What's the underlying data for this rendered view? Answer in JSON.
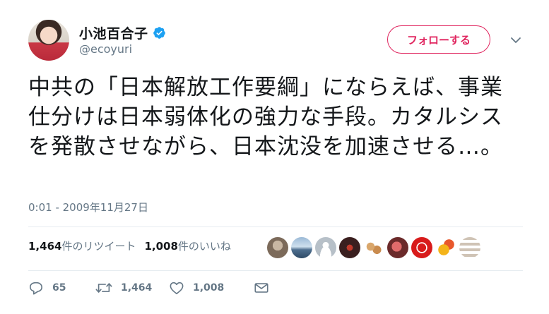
{
  "author": {
    "display_name": "小池百合子",
    "handle": "@ecoyuri",
    "verified": true
  },
  "follow_button": {
    "label": "フォローする"
  },
  "tweet": {
    "text": "中共の「日本解放工作要綱」にならえば、事業仕分けは日本弱体化の強力な手段。カタルシスを発散させながら、日本沈没を加速させる…。",
    "timestamp": "0:01 - 2009年11月27日"
  },
  "stats": {
    "retweet_count": "1,464",
    "retweet_label": "件のリツイート",
    "like_count": "1,008",
    "like_label": "件のいいね"
  },
  "actions": {
    "reply_count": "65",
    "retweet_count": "1,464",
    "like_count": "1,008"
  },
  "colors": {
    "accent": "#e0245e",
    "verified": "#1da1f2",
    "muted": "#657786"
  },
  "icons": {
    "verified": "verified-badge-icon",
    "caret": "chevron-down-icon",
    "reply": "reply-icon",
    "retweet": "retweet-icon",
    "like": "heart-icon",
    "dm": "envelope-icon"
  }
}
